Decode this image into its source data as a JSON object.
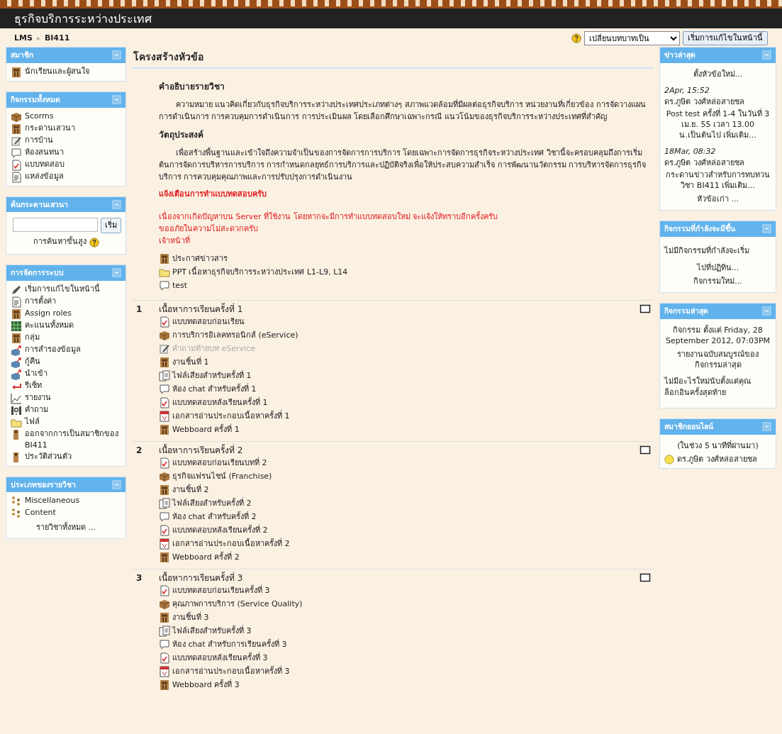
{
  "header": {
    "title": "ธุรกิจบริการระหว่างประเทศ"
  },
  "breadcrumb": [
    "LMS",
    "BI411"
  ],
  "role_switch": {
    "value": "เปลี่ยนบทบาทเป็น"
  },
  "edit_button": "เริ่มการแก้ไขในหน้านี้",
  "left_blocks": [
    {
      "title": "สมาชิก",
      "content": [
        {
          "kind": "forum",
          "label": "นักเรียนและผู้สนใจ"
        }
      ]
    },
    {
      "title": "กิจกรรมทั้งหมด",
      "content": [
        {
          "kind": "scorm",
          "label": "Scorms"
        },
        {
          "kind": "forum",
          "label": "กระดานเสวนา"
        },
        {
          "kind": "assignment",
          "label": "การบ้าน"
        },
        {
          "kind": "chat",
          "label": "ห้องสนทนา"
        },
        {
          "kind": "quiz",
          "label": "แบบทดสอบ"
        },
        {
          "kind": "resource",
          "label": "แหล่งข้อมูล"
        }
      ]
    },
    {
      "title": "ค้นกระดานเสวนา",
      "content": [
        {
          "kind": "search",
          "button": "เริ่ม",
          "link": "การค้นหาขั้นสูง"
        }
      ]
    },
    {
      "title": "การจัดการระบบ",
      "content": [
        {
          "kind": "edit",
          "label": "เริ่มการแก้ไขในหน้านี้"
        },
        {
          "kind": "settings",
          "label": "การตั้งค่า"
        },
        {
          "kind": "roles",
          "label": "Assign roles"
        },
        {
          "kind": "grades",
          "label": "คะแนนทั้งหมด"
        },
        {
          "kind": "groups",
          "label": "กลุ่ม"
        },
        {
          "kind": "backup",
          "label": "การสำรองข้อมูล"
        },
        {
          "kind": "restore",
          "label": "กู้คืน"
        },
        {
          "kind": "import",
          "label": "นำเข้า"
        },
        {
          "kind": "reset",
          "label": "รีเซ็ท"
        },
        {
          "kind": "report",
          "label": "รายงาน"
        },
        {
          "kind": "questions",
          "label": "คำถาม"
        },
        {
          "kind": "files",
          "label": "ไฟล์"
        },
        {
          "kind": "unenrol",
          "label": "ออกจากการเป็นสมาชิกของ BI411"
        },
        {
          "kind": "profile",
          "label": "ประวัติส่วนตัว"
        }
      ]
    },
    {
      "title": "ประเภทของรายวิชา",
      "content": [
        {
          "kind": "category",
          "label": "Miscellaneous"
        },
        {
          "kind": "category",
          "label": "Content"
        },
        {
          "kind": "link",
          "text": "รายวิชาทั้งหมด ..."
        }
      ]
    }
  ],
  "main": {
    "heading": "โครงสร้างหัวข้อ",
    "summary": [
      {
        "kind": "heading",
        "text": "คำอธิบายรายวิชา"
      },
      {
        "kind": "paragraph",
        "text": "ความหมาย แนวคิดเกี่ยวกับธุรกิจบริการระหว่างประเทศประเภทต่างๆ สภาพแวดล้อมที่มีผลต่อธุรกิจบริการ หน่วยงานที่เกี่ยวข้อง การจัดวางแผน การดำเนินการ การควบคุมการดำเนินการ การประเมินผล โดยเลือกศึกษาเฉพาะกรณี แนวโน้มของธุรกิจบริการระหว่างประเทศที่สำคัญ"
      },
      {
        "kind": "heading",
        "text": "วัตถุประสงค์"
      },
      {
        "kind": "paragraph",
        "text": "เพื่อสร้างพื้นฐานและเข้าใจถึงความจำเป็นของการจัดการการบริการ โดยเฉพาะการจัดการธุรกิจระหว่างประเทศ วิชานี้จะครอบคลุมถึงการเริ่มต้นการจัดการบริหารการบริการ การกำหนดกลยุทธ์การบริการและปฏิบัติจริงเพื่อให้ประสบความสำเร็จ การพัฒนานวัตกรรม การบริหารจัดการธุรกิจบริการ การควบคุมคุณภาพและการปรับปรุงการดำเนินงาน"
      },
      {
        "kind": "notice-title",
        "text": "แจ้งเตือนการทำแบบทดสอบครับ"
      },
      {
        "kind": "notice",
        "text": "เนื่องจากเกิดปัญหาบน Server ที่ใช้งาน โดยหากจะมีการทำแบบทดสอบใหม่ จะแจ้งให้ทราบอีกครั้งครับ"
      },
      {
        "kind": "notice",
        "text": "ขออภัยในความไม่สะดวกครับ"
      },
      {
        "kind": "notice",
        "text": "เจ้าหน้าที่"
      }
    ],
    "activities": [
      {
        "kind": "forum",
        "label": "ประกาศข่าวสาร",
        "dimmed": false
      },
      {
        "kind": "folder",
        "label": "PPT เนื้อหาธุรกิจบริการระหว่างประเทศ L1-L9, L14",
        "dimmed": false
      },
      {
        "kind": "chat",
        "label": "test",
        "dimmed": false
      }
    ],
    "sections": [
      {
        "number": "1",
        "title": "เนื้อหาการเรียนครั้งที่ 1",
        "activities": [
          {
            "kind": "quiz",
            "label": "แบบทดสอบก่อนเรียน",
            "dimmed": false
          },
          {
            "kind": "scorm",
            "label": "การบริการอิเลคทรอนิกส์ (eService)",
            "dimmed": false
          },
          {
            "kind": "assignment",
            "label": "คำถามท้ายบท eService",
            "dimmed": true
          },
          {
            "kind": "forum",
            "label": "งานชิ้นที่ 1",
            "dimmed": false
          },
          {
            "kind": "audio",
            "label": "ไฟล์เสียงสำหรับครั้งที่ 1",
            "dimmed": false
          },
          {
            "kind": "chat",
            "label": "ห้อง chat สำหรับครั้งที่ 1",
            "dimmed": false
          },
          {
            "kind": "quiz",
            "label": "แบบทดสอบหลังเรียนครั้งที่ 1",
            "dimmed": false
          },
          {
            "kind": "pdf",
            "label": "เอกสารอ่านประกอบเนื้อหาครั้งที่ 1",
            "dimmed": false
          },
          {
            "kind": "forum",
            "label": "Webboard ครั้งที่ 1",
            "dimmed": false
          }
        ]
      },
      {
        "number": "2",
        "title": "เนื้อหาการเรียนครั้งที่ 2",
        "activities": [
          {
            "kind": "quiz",
            "label": "แบบทดสอบก่อนเรียนบทที่ 2",
            "dimmed": false
          },
          {
            "kind": "scorm",
            "label": "ธุรกิจแฟรนไชน์ (Franchise)",
            "dimmed": false
          },
          {
            "kind": "forum",
            "label": "งานชิ้นที่ 2",
            "dimmed": false
          },
          {
            "kind": "audio",
            "label": "ไฟล์เสียงสำหรับครั้งที่ 2",
            "dimmed": false
          },
          {
            "kind": "chat",
            "label": "ห้อง chat สำหรับครั้งที่ 2",
            "dimmed": false
          },
          {
            "kind": "quiz",
            "label": "แบบทดสอบหลังเรียนครั้งที่ 2",
            "dimmed": false
          },
          {
            "kind": "pdf",
            "label": "เอกสารอ่านประกอบเนื้อหาครั้งที่ 2",
            "dimmed": false
          },
          {
            "kind": "forum",
            "label": "Webboard ครั้งที่ 2",
            "dimmed": false
          }
        ]
      },
      {
        "number": "3",
        "title": "เนื้อหาการเรียนครั้งที่ 3",
        "activities": [
          {
            "kind": "quiz",
            "label": "แบบทดสอบก่อนเรียนครั้งที่ 3",
            "dimmed": false
          },
          {
            "kind": "scorm",
            "label": "คุณภาพการบริการ (Service Quality)",
            "dimmed": false
          },
          {
            "kind": "forum",
            "label": "งานชิ้นที่ 3",
            "dimmed": false
          },
          {
            "kind": "audio",
            "label": "ไฟล์เสียงสำหรับครั้งที่ 3",
            "dimmed": false
          },
          {
            "kind": "chat",
            "label": "ห้อง chat สำหรับการเรียนครั้งที่ 3",
            "dimmed": false
          },
          {
            "kind": "quiz",
            "label": "แบบทดสอบหลังเรียนครั้งที่ 3",
            "dimmed": false
          },
          {
            "kind": "pdf",
            "label": "เอกสารอ่านประกอบเนื้อหาครั้งที่ 3",
            "dimmed": false
          },
          {
            "kind": "forum",
            "label": "Webboard ครั้งที่ 3",
            "dimmed": false
          }
        ]
      }
    ]
  },
  "right_blocks": [
    {
      "title": "ข่าวล่าสุด",
      "content": [
        {
          "kind": "link",
          "text": "ตั้งหัวข้อใหม่..."
        },
        {
          "kind": "news",
          "date": "2Apr, 15:52",
          "author": "ดร.ภูษิต วงศ์หล่อสายชล",
          "text": "Post test ครั้งที่ 1-4 ในวันที่ 3 เม.ย. 55 เวลา 13.00 น.เป็นต้นไป เพิ่มเติม..."
        },
        {
          "kind": "news",
          "date": "18Mar, 08:32",
          "author": "ดร.ภูษิต วงศ์หล่อสายชล",
          "text": "กระดานข่าวสำหรับการทบทวนวิชา BI411 เพิ่มเติม..."
        },
        {
          "kind": "link",
          "text": "หัวข้อเก่า ..."
        }
      ]
    },
    {
      "title": "กิจกรรมที่กำลังจะมีขึ้น",
      "content": [
        {
          "kind": "text",
          "text": "ไม่มีกิจกรรมที่กำลังจะเริ่ม"
        },
        {
          "kind": "link",
          "text": "ไปที่ปฏิทิน..."
        },
        {
          "kind": "link",
          "text": "กิจกรรมใหม่..."
        }
      ]
    },
    {
      "title": "กิจกรรมล่าสุด",
      "content": [
        {
          "kind": "note",
          "text": "กิจกรรม ตั้งแต่ Friday, 28 September 2012, 07:03PM"
        },
        {
          "kind": "link",
          "text": "รายงานฉบับสมบูรณ์ของกิจกรรมล่าสุด"
        },
        {
          "kind": "text",
          "text": "ไม่มีอะไรใหม่นับตั้งแต่คุณล็อกอินครั้งสุดท้าย"
        }
      ]
    },
    {
      "title": "สมาชิกออนไลน์",
      "content": [
        {
          "kind": "note",
          "text": "(ในช่วง 5 นาทีที่ผ่านมา)"
        },
        {
          "kind": "user",
          "name": "ดร.ภูษิต วงศ์หล่อสายชล"
        }
      ]
    }
  ]
}
